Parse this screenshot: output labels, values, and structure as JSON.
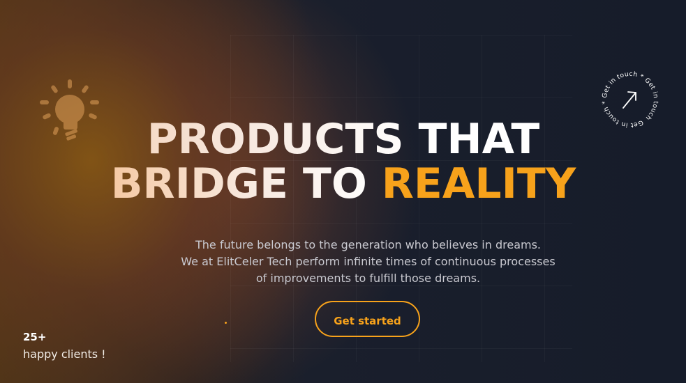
{
  "hero": {
    "headline_line1": "PRODUCTS THAT",
    "headline_line2_part1": "BRIDGE TO ",
    "headline_line2_highlight": "REALITY",
    "subtitle_line1": "The future belongs to the generation who believes in dreams.",
    "subtitle_line2": "We at ElitCeler Tech perform infinite times of continuous processes",
    "subtitle_line3": "of improvements to fulfill those dreams.",
    "cta_label": "Get started"
  },
  "stats": {
    "count": "25+",
    "label": "happy clients !"
  },
  "get_in_touch": {
    "circle_text": "Get in touch * Get in touch * Get in touch * ",
    "icon": "arrow-up-right-icon"
  },
  "decor": {
    "icon": "lightbulb-icon"
  },
  "colors": {
    "accent": "#f7a21b",
    "background": "#151b29",
    "text_muted": "#c9c9d0"
  }
}
